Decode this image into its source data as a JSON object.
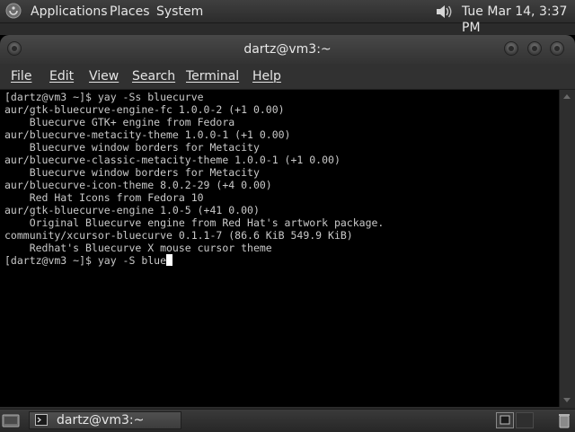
{
  "top_panel": {
    "menus": [
      "Applications",
      "Places",
      "System"
    ],
    "clock": "Tue Mar 14,  3:37 PM",
    "icons": {
      "logo": "distro-logo-icon",
      "volume": "volume-icon"
    }
  },
  "window": {
    "title": "dartz@vm3:~",
    "menus": [
      "File",
      "Edit",
      "View",
      "Search",
      "Terminal",
      "Help"
    ]
  },
  "terminal": {
    "lines": [
      "[dartz@vm3 ~]$ yay -Ss bluecurve",
      "aur/gtk-bluecurve-engine-fc 1.0.0-2 (+1 0.00)",
      "    Bluecurve GTK+ engine from Fedora",
      "aur/bluecurve-metacity-theme 1.0.0-1 (+1 0.00)",
      "    Bluecurve window borders for Metacity",
      "aur/bluecurve-classic-metacity-theme 1.0.0-1 (+1 0.00)",
      "    Bluecurve window borders for Metacity",
      "aur/bluecurve-icon-theme 8.0.2-29 (+4 0.00)",
      "    Red Hat Icons from Fedora 10",
      "aur/gtk-bluecurve-engine 1.0-5 (+41 0.00)",
      "    Original Bluecurve engine from Red Hat's artwork package.",
      "community/xcursor-bluecurve 0.1.1-7 (86.6 KiB 549.9 KiB)",
      "    Redhat's Bluecurve X mouse cursor theme"
    ],
    "prompt_line": "[dartz@vm3 ~]$ yay -S blue"
  },
  "bottom_panel": {
    "taskbar_label": "dartz@vm3:~",
    "icons": {
      "show_desktop": "show-desktop-icon",
      "task": "terminal-icon",
      "trash": "trash-icon"
    }
  },
  "colors": {
    "panel": "#333333",
    "terminal_bg": "#000000",
    "terminal_fg": "#c9c9c9",
    "cursor": "#ffffff"
  }
}
